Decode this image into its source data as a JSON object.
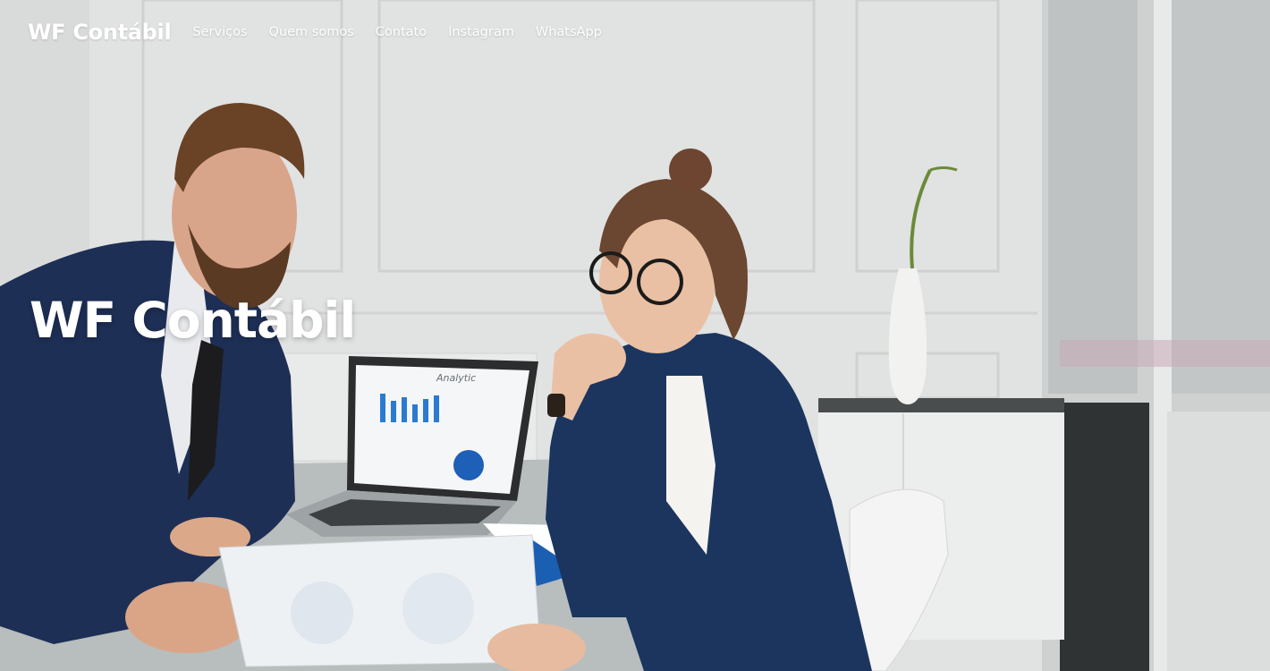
{
  "navbar": {
    "brand": "WF Contábil",
    "links": [
      {
        "label": "Serviços"
      },
      {
        "label": "Quem somos"
      },
      {
        "label": "Contato"
      },
      {
        "label": "Instagram"
      },
      {
        "label": "WhatsApp"
      }
    ]
  },
  "hero": {
    "title": "WF Contábil",
    "laptop_screen_title": "Analytic"
  },
  "colors": {
    "text": "#ffffff",
    "wall": "#e3e4e4",
    "blazer": "#1b355f"
  }
}
